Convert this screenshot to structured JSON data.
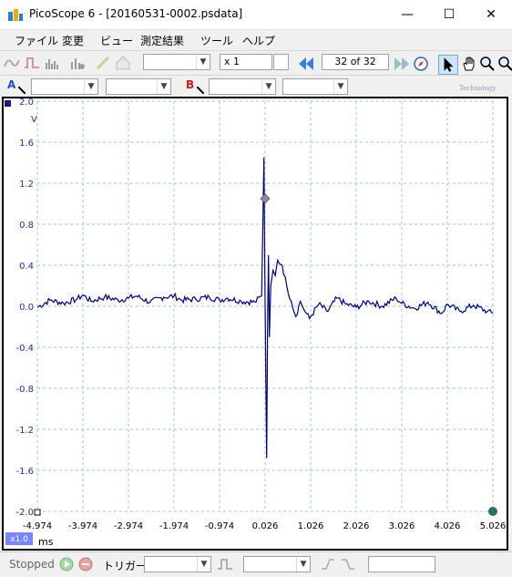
{
  "window": {
    "title": "PicoScope 6 - [20160531-0002.psdata]",
    "minimize": "—",
    "maximize": "☐",
    "close": "✕"
  },
  "menu": [
    "ファイル",
    "変更",
    "ビュー",
    "測定結果",
    "ツール",
    "ヘルプ"
  ],
  "toolbar": {
    "zoom_value": "x 1",
    "buffer_position": "32 of 32"
  },
  "channels": {
    "a_label": "A",
    "b_label": "B",
    "brand_text": "Technology"
  },
  "scope": {
    "y_unit": "V",
    "x_unit": "ms",
    "zoom_badge": "x1.0",
    "y_ticks": [
      "2.0",
      "1.6",
      "1.2",
      "0.8",
      "0.4",
      "0.0",
      "-0.4",
      "-0.8",
      "-1.2",
      "-1.6",
      "-2.0"
    ],
    "x_ticks": [
      "-4.974",
      "-3.974",
      "-2.974",
      "-1.974",
      "-0.974",
      "0.026",
      "1.026",
      "2.026",
      "3.026",
      "4.026",
      "5.026"
    ],
    "trace_color": "#000080",
    "grid_color": "#9cc"
  },
  "chart_data": {
    "type": "line",
    "xlabel": "ms",
    "ylabel": "V",
    "xlim": [
      -4.974,
      5.026
    ],
    "ylim": [
      -2.0,
      2.0
    ],
    "trigger_marker": {
      "x": 0.026,
      "y": 1.05
    },
    "series": [
      {
        "x": [
          -4.974,
          -4.7,
          -4.4,
          -4.1,
          -3.974,
          -3.8,
          -3.5,
          -3.2,
          -2.974,
          -2.8,
          -2.5,
          -2.2,
          -1.974,
          -1.8,
          -1.5,
          -1.2,
          -0.974,
          -0.8,
          -0.5,
          -0.2,
          -0.05,
          0.0,
          0.02,
          0.04,
          0.06,
          0.08,
          0.1,
          0.12,
          0.15,
          0.2,
          0.25,
          0.3,
          0.4,
          0.5,
          0.6,
          0.7,
          0.8,
          0.9,
          1.0,
          1.2,
          1.4,
          1.6,
          1.8,
          2.026,
          2.3,
          2.6,
          2.9,
          3.026,
          3.3,
          3.6,
          3.9,
          4.026,
          4.3,
          4.6,
          4.9,
          5.026
        ],
        "y": [
          -0.01,
          0.06,
          0.03,
          0.07,
          0.11,
          0.05,
          0.09,
          0.06,
          0.08,
          0.1,
          0.04,
          0.09,
          0.1,
          0.06,
          0.07,
          0.09,
          0.06,
          0.08,
          0.05,
          0.04,
          0.1,
          1.45,
          0.3,
          -0.6,
          -1.48,
          -0.2,
          0.5,
          -0.3,
          0.2,
          0.35,
          0.3,
          0.45,
          0.4,
          0.2,
          0.05,
          -0.1,
          0.05,
          -0.05,
          -0.12,
          0.02,
          -0.05,
          0.08,
          0.02,
          -0.01,
          0.05,
          0.0,
          0.08,
          0.03,
          -0.02,
          0.04,
          -0.07,
          0.02,
          -0.05,
          0.01,
          -0.05,
          -0.07
        ]
      }
    ]
  },
  "status": {
    "state": "Stopped",
    "trigger_label": "トリガー"
  }
}
